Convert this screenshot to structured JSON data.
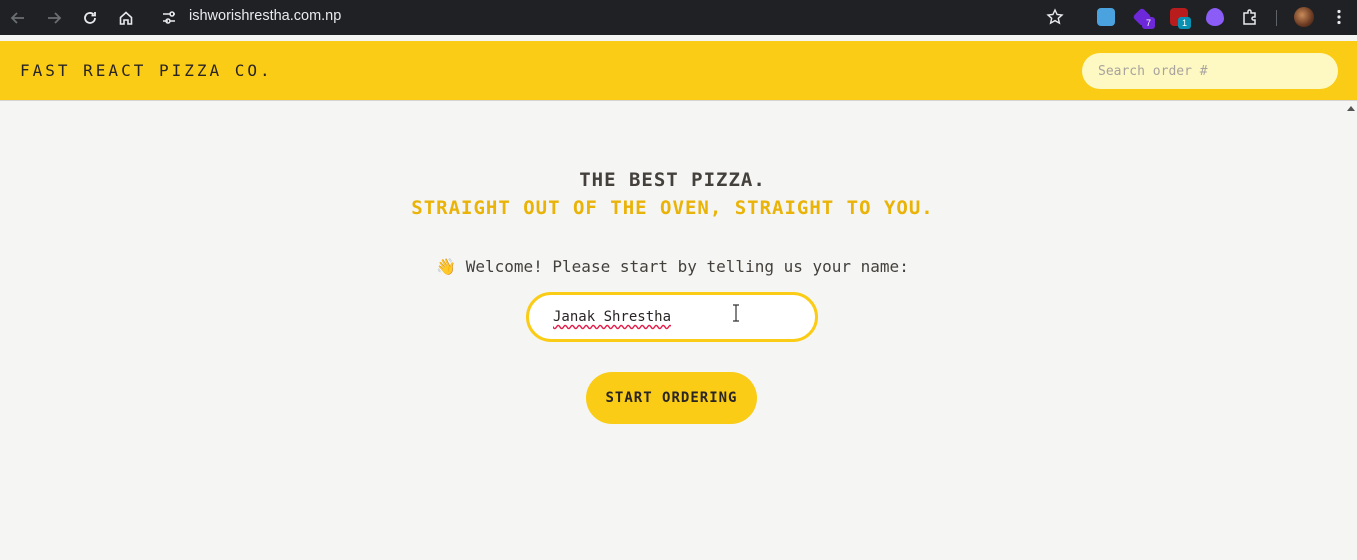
{
  "browser": {
    "url": "ishworishrestha.com.np",
    "extensions": [
      {
        "name": "printer-extension-icon",
        "badge": "",
        "color": "#4aa3df"
      },
      {
        "name": "graduation-cap-extension-icon",
        "badge": "7",
        "color": "#6d28d9"
      },
      {
        "name": "shield-extension-icon",
        "badge": "1",
        "color": "#b91c1c"
      },
      {
        "name": "flame-extension-icon",
        "badge": "",
        "color": "#8b5cf6"
      }
    ]
  },
  "header": {
    "brand": "Fast React Pizza Co.",
    "search_placeholder": "Search order #"
  },
  "hero": {
    "line1": "THE BEST PIZZA.",
    "line2": "STRAIGHT OUT OF THE OVEN, STRAIGHT TO YOU."
  },
  "form": {
    "prompt": "👋 Welcome! Please start by telling us your name:",
    "name_value": "Janak Shrestha",
    "button_label": "START ORDERING"
  },
  "colors": {
    "accent": "#facc15",
    "accent_text": "#eab308",
    "text": "#44403c"
  }
}
